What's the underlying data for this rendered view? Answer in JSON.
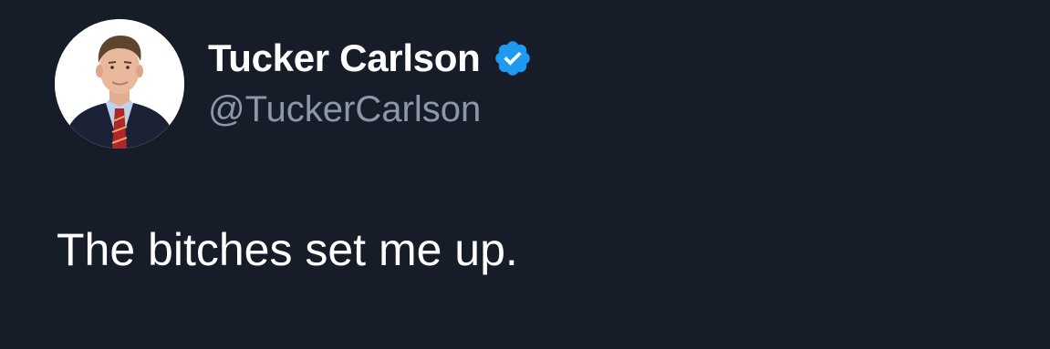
{
  "tweet": {
    "author": {
      "display_name": "Tucker Carlson",
      "handle": "@TuckerCarlson",
      "verified": true,
      "avatar_icon": "profile-photo"
    },
    "text": "The bitches set me up."
  },
  "colors": {
    "background": "#161d29",
    "name": "#ffffff",
    "handle": "#8b98a5",
    "verified_badge": "#1d9bf0",
    "text": "#ffffff"
  }
}
